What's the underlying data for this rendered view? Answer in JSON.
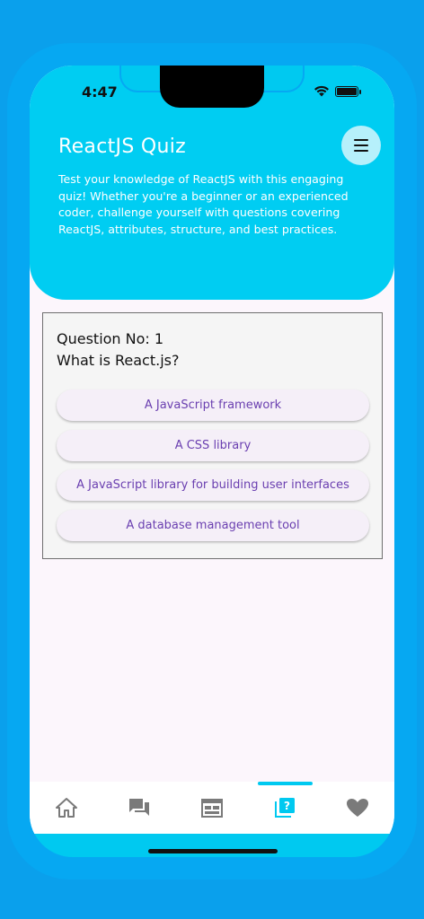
{
  "status_bar": {
    "time": "4:47"
  },
  "header": {
    "title": "ReactJS Quiz",
    "description": "Test your knowledge of ReactJS with this engaging quiz! Whether you're a beginner or an experienced coder, challenge yourself with questions covering ReactJS, attributes, structure, and best practices.",
    "menu_icon": "hamburger-menu-icon"
  },
  "quiz": {
    "question_number": "Question No: 1",
    "question_text": "What is React.js?",
    "options": [
      "A JavaScript framework",
      "A CSS library",
      "A JavaScript library for building user interfaces",
      "A database management tool"
    ]
  },
  "tab_bar": {
    "active_index": 3,
    "tabs": [
      {
        "icon": "home-icon"
      },
      {
        "icon": "chat-icon"
      },
      {
        "icon": "calendar-icon"
      },
      {
        "icon": "quiz-icon"
      },
      {
        "icon": "heart-icon"
      }
    ]
  },
  "colors": {
    "accent": "#00c9f0",
    "header_bg": "#00cdf2",
    "option_text": "#6a3fb0",
    "icon_gray": "#7a7a7a",
    "page_bg": "#0aa0ec"
  }
}
